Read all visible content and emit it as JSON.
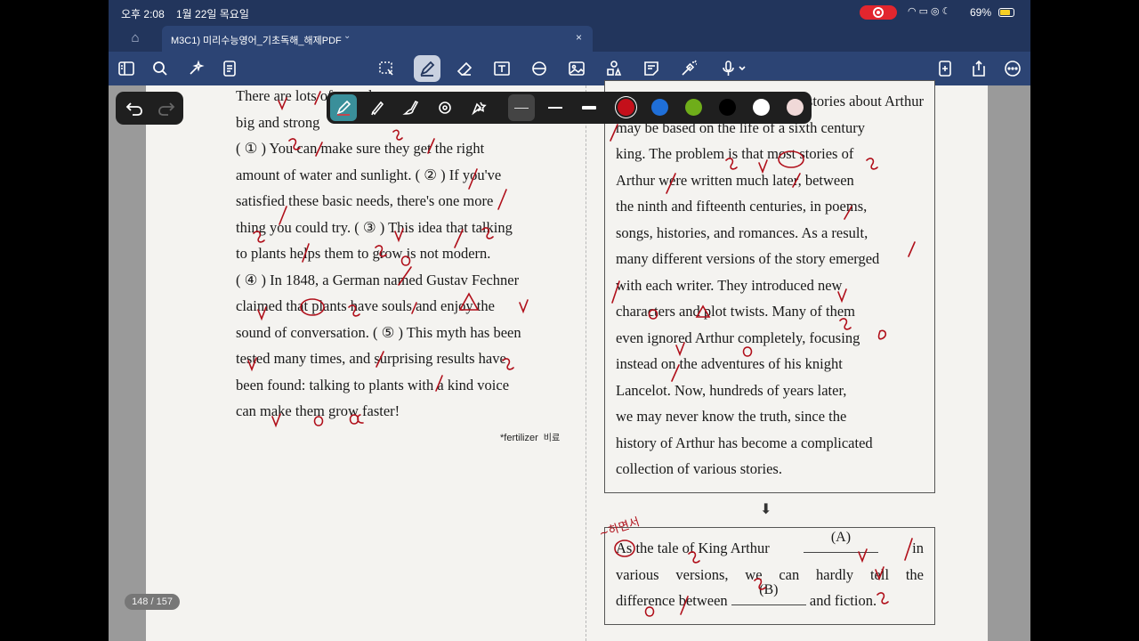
{
  "status_bar": {
    "time": "오후 2:08",
    "date": "1월 22일 목요일",
    "battery": "69%",
    "record_color": "#e2262e",
    "icons": [
      "wifi-icon",
      "screen-mirror-icon",
      "lock-rotation-icon",
      "moon-icon"
    ]
  },
  "tab": {
    "home_icon": "home-icon",
    "title": "M3C1) 미리수능영어_기초독해_해제PDF",
    "chevron": "⌄",
    "close": "×"
  },
  "toolbar": {
    "left": [
      "sidebar-icon",
      "search-icon",
      "ai-sparkle-icon",
      "document-outline-icon"
    ],
    "center": [
      "lasso-icon",
      "pen-icon",
      "eraser-icon",
      "textbox-icon",
      "shapes-icon",
      "image-icon",
      "elements-icon",
      "sticky-note-icon",
      "laser-pointer-icon",
      "microphone-icon"
    ],
    "right": [
      "add-page-icon",
      "share-icon",
      "more-icon"
    ]
  },
  "pen_palette": {
    "tools": [
      "fountain-pen-icon",
      "ball-pen-icon",
      "brush-pen-icon",
      "shape-recognition-icon",
      "favorites-icon"
    ],
    "colors": [
      "#c40f1a",
      "#1f6fd8",
      "#6fad1a",
      "#000000",
      "#ffffff",
      "#f0d9d8"
    ],
    "selected_color": "#c40f1a"
  },
  "document": {
    "left_lines": [
      "There are lots of ... and ... to",
      "big and strong",
      "( ① ) You can make sure they get the right",
      "amount of water and sunlight. ( ② ) If you've",
      "satisfied these basic needs, there's one more",
      "thing you could try. ( ③ ) This idea that talking",
      "to plants helps them to grow is not modern.",
      "( ④ ) In 1848, a German named Gustav Fechner",
      "claimed that plants have souls and enjoy the",
      "sound of conversation. ( ⑤ ) This myth has been",
      "tested many times, and surprising results have",
      "been found: talking to plants with a kind voice",
      "can make them grow faster!"
    ],
    "footnote": "*fertilizer",
    "footnote_ko": "비료",
    "right_lines": [
      "... stories about Arthur",
      "may be based on the life of a sixth century",
      "king. The problem is that most stories of",
      "Arthur were written much later, between",
      "the ninth and fifteenth centuries, in poems,",
      "songs, histories, and romances. As a result,",
      "many different versions of the story emerged",
      "with each writer. They introduced new",
      "characters and plot twists. Many of them",
      "even ignored Arthur completely, focusing",
      "instead on the adventures of his knight",
      "Lancelot. Now, hundreds of years later,",
      "we may never know the truth, since the",
      "history of Arthur has become a complicated",
      "collection of various stories."
    ],
    "arrow": "⬇",
    "summary": {
      "line1_pre": "As the tale of King Arthur",
      "blank_a": "(A)",
      "line1_post": "in",
      "line2": "various versions, we can hardly tell the",
      "line3_pre": "difference between",
      "blank_b": "(B)",
      "line3_post": "and fiction."
    },
    "ink_note": "~하면서"
  },
  "page_indicator": "148 / 157"
}
